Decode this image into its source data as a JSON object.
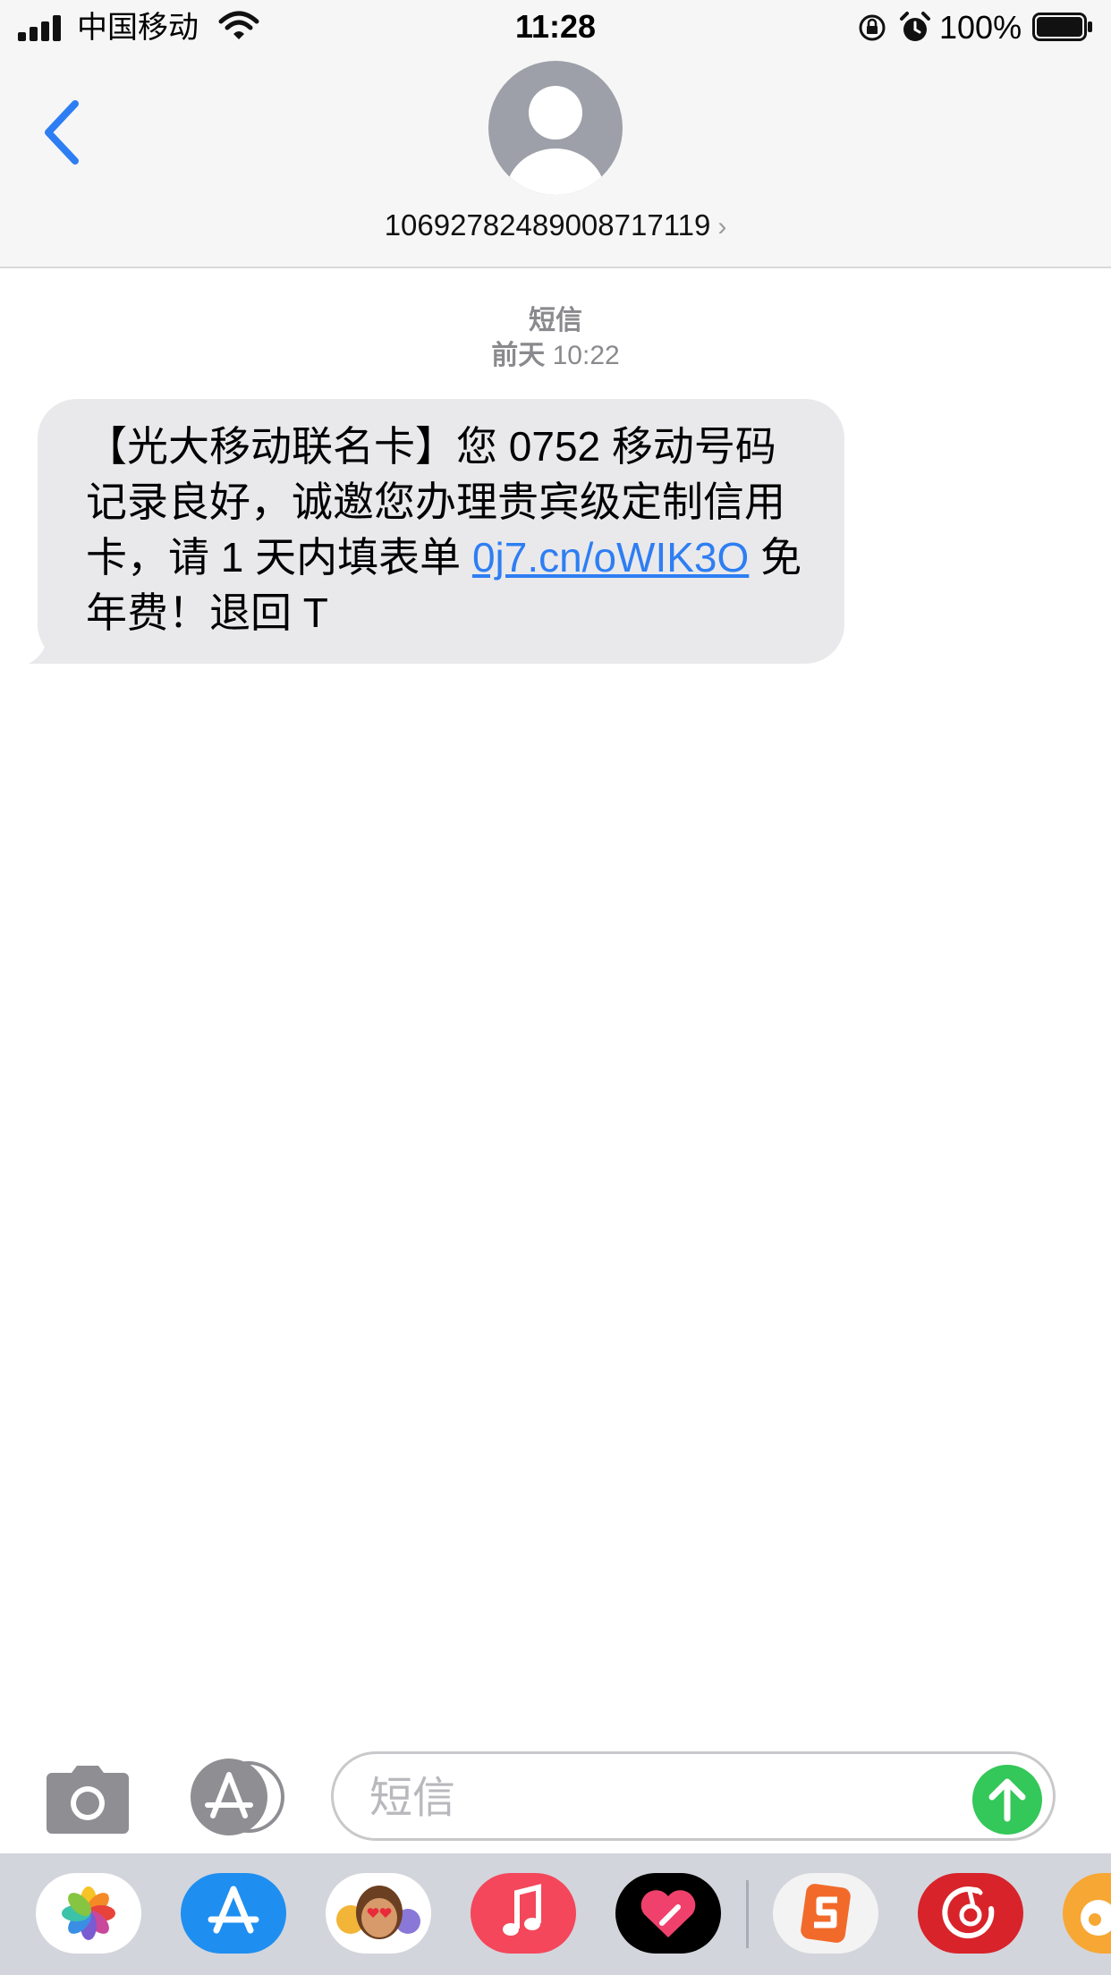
{
  "status_bar": {
    "carrier": "中国移动",
    "time": "11:28",
    "battery_percent": "100%",
    "battery_level": 1.0,
    "icons": [
      "signal-icon",
      "wifi-icon",
      "rotation-lock-icon",
      "alarm-icon",
      "battery-icon"
    ]
  },
  "header": {
    "back_icon": "chevron-left-icon",
    "avatar_icon": "person-icon",
    "contact_number": "106927824890087171​19",
    "contact_chevron": "›"
  },
  "conversation": {
    "service_label": "短信",
    "date_day": "前天",
    "date_time": "10:22",
    "message": {
      "text_before_link": "【光大移动联名卡】您 0752 移动号码记录良好，诚邀您办理贵宾级定制信用卡，请 1 天内填表单 ",
      "link_text": "0j7.cn/oWIK3O",
      "text_after_link": " 免年费！退回 T"
    }
  },
  "composer": {
    "camera_icon": "camera-icon",
    "apps_icon": "app-store-icon",
    "placeholder": "短信",
    "value": "",
    "send_icon": "send-arrow-icon",
    "send_color": "#34c759"
  },
  "dock": {
    "apps": [
      {
        "name": "photos-icon",
        "color": "#ffffff"
      },
      {
        "name": "app-store-icon",
        "color": "#1e8ff0"
      },
      {
        "name": "memoji-stickers-icon",
        "color": "#ffffff"
      },
      {
        "name": "music-icon",
        "color": "#f4475b"
      },
      {
        "name": "fitness-heart-icon",
        "color": "#000000"
      },
      {
        "name": "sogou-input-icon",
        "color": "#f3f3f3"
      },
      {
        "name": "netease-music-icon",
        "color": "#d8232a"
      },
      {
        "name": "weibo-icon",
        "color": "#f7a733"
      }
    ]
  },
  "colors": {
    "accent_blue": "#2e7ef3",
    "bubble_gray": "#e9e9eb",
    "meta_gray": "#8a8a8e"
  }
}
